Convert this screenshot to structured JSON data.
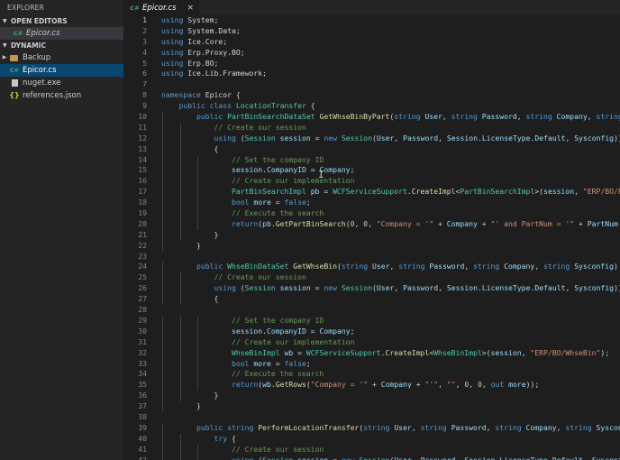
{
  "sidebar": {
    "title": "EXPLORER",
    "open_editors_label": "OPEN EDITORS",
    "open_editors": [
      {
        "label": "Epicor.cs",
        "icon": "csharp-file-icon"
      }
    ],
    "folder_label": "DYNAMIC",
    "items": [
      {
        "label": "Backup",
        "icon": "folder-icon"
      },
      {
        "label": "Epicor.cs",
        "icon": "csharp-file-icon"
      },
      {
        "label": "nuget.exe",
        "icon": "exe-file-icon"
      },
      {
        "label": "references.json",
        "icon": "json-file-icon"
      }
    ]
  },
  "tabs": [
    {
      "label": "Epicor.cs",
      "close": "×",
      "icon_glyph": "C#"
    }
  ],
  "icon_glyphs": {
    "csharp": "C#",
    "json": "{}"
  },
  "colors": {
    "keyword": "#569cd6",
    "type": "#4ec9b0",
    "function": "#dcdcaa",
    "variable": "#9cdcfe",
    "string": "#ce9178",
    "comment": "#6a9955",
    "number": "#b5cea8",
    "selection": "#094771"
  },
  "current_line": 1,
  "lines": [
    [
      [
        "k",
        "using"
      ],
      [
        "p",
        " System;"
      ]
    ],
    [
      [
        "k",
        "using"
      ],
      [
        "p",
        " System.Data;"
      ]
    ],
    [
      [
        "k",
        "using"
      ],
      [
        "p",
        " Ice.Core;"
      ]
    ],
    [
      [
        "k",
        "using"
      ],
      [
        "p",
        " Erp.Proxy.BO;"
      ]
    ],
    [
      [
        "k",
        "using"
      ],
      [
        "p",
        " Erp.BO;"
      ]
    ],
    [
      [
        "k",
        "using"
      ],
      [
        "p",
        " Ice.Lib.Framework;"
      ]
    ],
    [],
    [
      [
        "k",
        "namespace"
      ],
      [
        "p",
        " Epicor {"
      ]
    ],
    [
      [
        "p",
        "    "
      ],
      [
        "k",
        "public"
      ],
      [
        "p",
        " "
      ],
      [
        "k",
        "class"
      ],
      [
        "p",
        " "
      ],
      [
        "t",
        "LocationTransfer"
      ],
      [
        "p",
        " {"
      ]
    ],
    [
      [
        "p",
        "        "
      ],
      [
        "k",
        "public"
      ],
      [
        "p",
        " "
      ],
      [
        "t",
        "PartBinSearchDataSet"
      ],
      [
        "p",
        " "
      ],
      [
        "f",
        "GetWhseBinByPart"
      ],
      [
        "p",
        "("
      ],
      [
        "k",
        "string"
      ],
      [
        "p",
        " "
      ],
      [
        "v",
        "User"
      ],
      [
        "p",
        ", "
      ],
      [
        "k",
        "string"
      ],
      [
        "p",
        " "
      ],
      [
        "v",
        "Password"
      ],
      [
        "p",
        ", "
      ],
      [
        "k",
        "string"
      ],
      [
        "p",
        " "
      ],
      [
        "v",
        "Company"
      ],
      [
        "p",
        ", "
      ],
      [
        "k",
        "string"
      ],
      [
        "p",
        " "
      ],
      [
        "v",
        "Sysconfig"
      ],
      [
        "p",
        ", "
      ],
      [
        "k",
        "string"
      ],
      [
        "p",
        " "
      ],
      [
        "v",
        "PartNum"
      ],
      [
        "p",
        ") {"
      ]
    ],
    [
      [
        "p",
        "            "
      ],
      [
        "c",
        "// Create our session"
      ]
    ],
    [
      [
        "p",
        "            "
      ],
      [
        "k",
        "using"
      ],
      [
        "p",
        " ("
      ],
      [
        "t",
        "Session"
      ],
      [
        "p",
        " "
      ],
      [
        "v",
        "session"
      ],
      [
        "p",
        " = "
      ],
      [
        "k",
        "new"
      ],
      [
        "p",
        " "
      ],
      [
        "t",
        "Session"
      ],
      [
        "p",
        "("
      ],
      [
        "v",
        "User"
      ],
      [
        "p",
        ", "
      ],
      [
        "v",
        "Password"
      ],
      [
        "p",
        ", "
      ],
      [
        "v",
        "Session"
      ],
      [
        "p",
        "."
      ],
      [
        "v",
        "LicenseType"
      ],
      [
        "p",
        "."
      ],
      [
        "v",
        "Default"
      ],
      [
        "p",
        ", "
      ],
      [
        "v",
        "Sysconfig"
      ],
      [
        "p",
        "))"
      ]
    ],
    [
      [
        "p",
        "            {"
      ]
    ],
    [
      [
        "p",
        "                "
      ],
      [
        "c",
        "// Set the company ID"
      ]
    ],
    [
      [
        "p",
        "                "
      ],
      [
        "v",
        "session"
      ],
      [
        "p",
        "."
      ],
      [
        "v",
        "CompanyID"
      ],
      [
        "p",
        " = "
      ],
      [
        "v",
        "Company"
      ],
      [
        "p",
        ";"
      ]
    ],
    [
      [
        "p",
        "                "
      ],
      [
        "c",
        "// Create our implementation"
      ]
    ],
    [
      [
        "p",
        "                "
      ],
      [
        "t",
        "PartBinSearchImpl"
      ],
      [
        "p",
        " "
      ],
      [
        "v",
        "pb"
      ],
      [
        "p",
        " = "
      ],
      [
        "t",
        "WCFServiceSupport"
      ],
      [
        "p",
        "."
      ],
      [
        "f",
        "CreateImpl"
      ],
      [
        "p",
        "<"
      ],
      [
        "t",
        "PartBinSearchImpl"
      ],
      [
        "p",
        ">("
      ],
      [
        "v",
        "session"
      ],
      [
        "p",
        ", "
      ],
      [
        "s",
        "\"ERP/BO/PartBinSearch\""
      ],
      [
        "p",
        ");"
      ]
    ],
    [
      [
        "p",
        "                "
      ],
      [
        "k",
        "bool"
      ],
      [
        "p",
        " "
      ],
      [
        "v",
        "more"
      ],
      [
        "p",
        " = "
      ],
      [
        "k",
        "false"
      ],
      [
        "p",
        ";"
      ]
    ],
    [
      [
        "p",
        "                "
      ],
      [
        "c",
        "// Execute the search"
      ]
    ],
    [
      [
        "p",
        "                "
      ],
      [
        "k",
        "return"
      ],
      [
        "p",
        "("
      ],
      [
        "v",
        "pb"
      ],
      [
        "p",
        "."
      ],
      [
        "f",
        "GetPartBinSearch"
      ],
      [
        "p",
        "("
      ],
      [
        "n",
        "0"
      ],
      [
        "p",
        ", "
      ],
      [
        "n",
        "0"
      ],
      [
        "p",
        ", "
      ],
      [
        "s",
        "\"Company = '\""
      ],
      [
        "p",
        " + "
      ],
      [
        "v",
        "Company"
      ],
      [
        "p",
        " + "
      ],
      [
        "s",
        "\"' and PartNum = '\""
      ],
      [
        "p",
        " + "
      ],
      [
        "v",
        "PartNum"
      ],
      [
        "p",
        " + "
      ],
      [
        "s",
        "\"'\""
      ],
      [
        "p",
        ");"
      ]
    ],
    [
      [
        "p",
        "            }"
      ]
    ],
    [
      [
        "p",
        "        }"
      ]
    ],
    [],
    [
      [
        "p",
        "        "
      ],
      [
        "k",
        "public"
      ],
      [
        "p",
        " "
      ],
      [
        "t",
        "WhseBinDataSet"
      ],
      [
        "p",
        " "
      ],
      [
        "f",
        "GetWhseBin"
      ],
      [
        "p",
        "("
      ],
      [
        "k",
        "string"
      ],
      [
        "p",
        " "
      ],
      [
        "v",
        "User"
      ],
      [
        "p",
        ", "
      ],
      [
        "k",
        "string"
      ],
      [
        "p",
        " "
      ],
      [
        "v",
        "Password"
      ],
      [
        "p",
        ", "
      ],
      [
        "k",
        "string"
      ],
      [
        "p",
        " "
      ],
      [
        "v",
        "Company"
      ],
      [
        "p",
        ", "
      ],
      [
        "k",
        "string"
      ],
      [
        "p",
        " "
      ],
      [
        "v",
        "Sysconfig"
      ],
      [
        "p",
        ") {"
      ]
    ],
    [
      [
        "p",
        "            "
      ],
      [
        "c",
        "// Create our session"
      ]
    ],
    [
      [
        "p",
        "            "
      ],
      [
        "k",
        "using"
      ],
      [
        "p",
        " ("
      ],
      [
        "t",
        "Session"
      ],
      [
        "p",
        " "
      ],
      [
        "v",
        "session"
      ],
      [
        "p",
        " = "
      ],
      [
        "k",
        "new"
      ],
      [
        "p",
        " "
      ],
      [
        "t",
        "Session"
      ],
      [
        "p",
        "("
      ],
      [
        "v",
        "User"
      ],
      [
        "p",
        ", "
      ],
      [
        "v",
        "Password"
      ],
      [
        "p",
        ", "
      ],
      [
        "v",
        "Session"
      ],
      [
        "p",
        "."
      ],
      [
        "v",
        "LicenseType"
      ],
      [
        "p",
        "."
      ],
      [
        "v",
        "Default"
      ],
      [
        "p",
        ", "
      ],
      [
        "v",
        "Sysconfig"
      ],
      [
        "p",
        "))"
      ]
    ],
    [
      [
        "p",
        "            {"
      ]
    ],
    [],
    [
      [
        "p",
        "                "
      ],
      [
        "c",
        "// Set the company ID"
      ]
    ],
    [
      [
        "p",
        "                "
      ],
      [
        "v",
        "session"
      ],
      [
        "p",
        "."
      ],
      [
        "v",
        "CompanyID"
      ],
      [
        "p",
        " = "
      ],
      [
        "v",
        "Company"
      ],
      [
        "p",
        ";"
      ]
    ],
    [
      [
        "p",
        "                "
      ],
      [
        "c",
        "// Create our implementation"
      ]
    ],
    [
      [
        "p",
        "                "
      ],
      [
        "t",
        "WhseBinImpl"
      ],
      [
        "p",
        " "
      ],
      [
        "v",
        "wb"
      ],
      [
        "p",
        " = "
      ],
      [
        "t",
        "WCFServiceSupport"
      ],
      [
        "p",
        "."
      ],
      [
        "f",
        "CreateImpl"
      ],
      [
        "p",
        "<"
      ],
      [
        "t",
        "WhseBinImpl"
      ],
      [
        "p",
        ">("
      ],
      [
        "v",
        "session"
      ],
      [
        "p",
        ", "
      ],
      [
        "s",
        "\"ERP/BO/WhseBin\""
      ],
      [
        "p",
        ");"
      ]
    ],
    [
      [
        "p",
        "                "
      ],
      [
        "k",
        "bool"
      ],
      [
        "p",
        " "
      ],
      [
        "v",
        "more"
      ],
      [
        "p",
        " = "
      ],
      [
        "k",
        "false"
      ],
      [
        "p",
        ";"
      ]
    ],
    [
      [
        "p",
        "                "
      ],
      [
        "c",
        "// Execute the search"
      ]
    ],
    [
      [
        "p",
        "                "
      ],
      [
        "k",
        "return"
      ],
      [
        "p",
        "("
      ],
      [
        "v",
        "wb"
      ],
      [
        "p",
        "."
      ],
      [
        "f",
        "GetRows"
      ],
      [
        "p",
        "("
      ],
      [
        "s",
        "\"Company = '\""
      ],
      [
        "p",
        " + "
      ],
      [
        "v",
        "Company"
      ],
      [
        "p",
        " + "
      ],
      [
        "s",
        "\"'\""
      ],
      [
        "p",
        ", "
      ],
      [
        "s",
        "\"\""
      ],
      [
        "p",
        ", "
      ],
      [
        "n",
        "0"
      ],
      [
        "p",
        ", "
      ],
      [
        "n",
        "0"
      ],
      [
        "p",
        ", "
      ],
      [
        "k",
        "out"
      ],
      [
        "p",
        " "
      ],
      [
        "v",
        "more"
      ],
      [
        "p",
        "));"
      ]
    ],
    [
      [
        "p",
        "            }"
      ]
    ],
    [
      [
        "p",
        "        }"
      ]
    ],
    [],
    [
      [
        "p",
        "        "
      ],
      [
        "k",
        "public"
      ],
      [
        "p",
        " "
      ],
      [
        "k",
        "string"
      ],
      [
        "p",
        " "
      ],
      [
        "f",
        "PerformLocationTransfer"
      ],
      [
        "p",
        "("
      ],
      [
        "k",
        "string"
      ],
      [
        "p",
        " "
      ],
      [
        "v",
        "User"
      ],
      [
        "p",
        ", "
      ],
      [
        "k",
        "string"
      ],
      [
        "p",
        " "
      ],
      [
        "v",
        "Password"
      ],
      [
        "p",
        ", "
      ],
      [
        "k",
        "string"
      ],
      [
        "p",
        " "
      ],
      [
        "v",
        "Company"
      ],
      [
        "p",
        ", "
      ],
      [
        "k",
        "string"
      ],
      [
        "p",
        " "
      ],
      [
        "v",
        "Sysconfig"
      ],
      [
        "p",
        ", "
      ],
      [
        "k",
        "string"
      ],
      [
        "p",
        " "
      ],
      [
        "v",
        "PartNum"
      ],
      [
        "p",
        ") {"
      ]
    ],
    [
      [
        "p",
        "            "
      ],
      [
        "k",
        "try"
      ],
      [
        "p",
        " {"
      ]
    ],
    [
      [
        "p",
        "                "
      ],
      [
        "c",
        "// Create our session"
      ]
    ],
    [
      [
        "p",
        "                "
      ],
      [
        "k",
        "using"
      ],
      [
        "p",
        " ("
      ],
      [
        "t",
        "Session"
      ],
      [
        "p",
        " "
      ],
      [
        "v",
        "session"
      ],
      [
        "p",
        " = "
      ],
      [
        "k",
        "new"
      ],
      [
        "p",
        " "
      ],
      [
        "t",
        "Session"
      ],
      [
        "p",
        "("
      ],
      [
        "v",
        "User"
      ],
      [
        "p",
        ", "
      ],
      [
        "v",
        "Password"
      ],
      [
        "p",
        ", "
      ],
      [
        "v",
        "Session"
      ],
      [
        "p",
        "."
      ],
      [
        "v",
        "LicenseType"
      ],
      [
        "p",
        "."
      ],
      [
        "v",
        "Default"
      ],
      [
        "p",
        ", "
      ],
      [
        "v",
        "Sysconfig"
      ],
      [
        "p",
        "))"
      ]
    ]
  ]
}
